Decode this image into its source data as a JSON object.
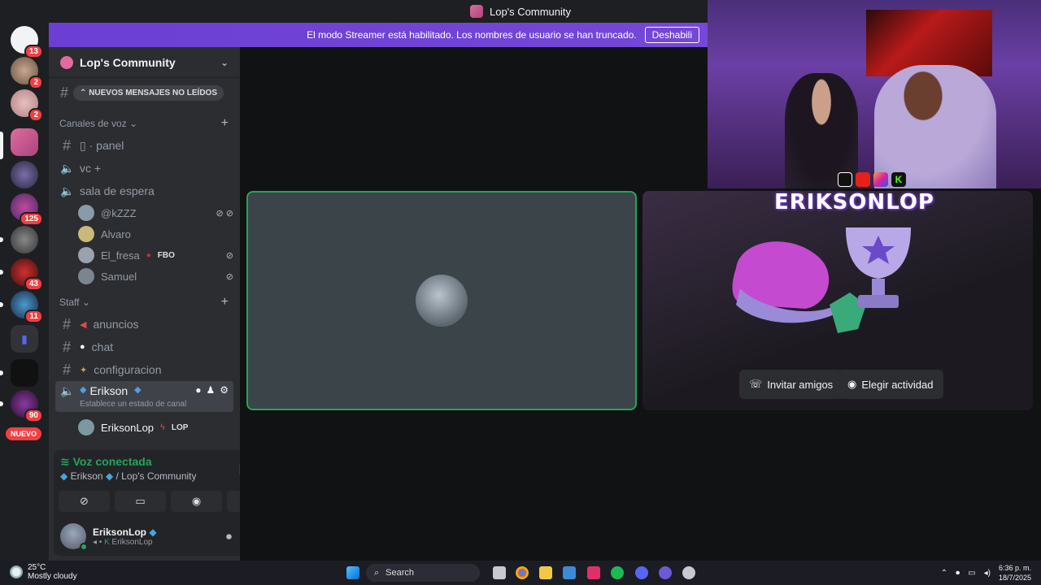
{
  "window": {
    "title": "Lop's Community"
  },
  "banner": {
    "text": "El modo Streamer está habilitado. Los nombres de usuario se han truncado.",
    "button": "Deshabili"
  },
  "server_rail": {
    "badges": [
      "13",
      "2",
      "2",
      "125",
      "43",
      "11",
      "90"
    ],
    "new_label": "NUEVO"
  },
  "sidebar": {
    "server_name": "Lop's Community",
    "unread_label": "NUEVOS MENSAJES NO LEÍDOS",
    "voice_category": "Canales de voz",
    "voice_channels": [
      {
        "name": "panel",
        "icon": "hash-icon"
      },
      {
        "name": "vc +",
        "icon": "speaker-icon"
      },
      {
        "name": "sala de espera",
        "icon": "speaker-icon"
      }
    ],
    "voice_users": [
      {
        "name": "@kZZZ",
        "tag": "",
        "color": "#8a9aa8"
      },
      {
        "name": "Alvaro",
        "tag": "",
        "color": "#c9b97a"
      },
      {
        "name": "El_fresa",
        "tag": "FBO",
        "color": "#9aa3ad"
      },
      {
        "name": "Samuel",
        "tag": "",
        "color": "#7a8590"
      }
    ],
    "staff_category": "Staff",
    "staff_channels": [
      {
        "name": "anuncios"
      },
      {
        "name": "chat"
      },
      {
        "name": "configuracion"
      }
    ],
    "active_channel": {
      "name": "Erikson",
      "status": "Establece un estado de canal"
    },
    "active_user": {
      "name": "EriksonLop",
      "tag": "LOP"
    }
  },
  "voice_panel": {
    "status": "Voz conectada",
    "channel": "Erikson",
    "server": "/ Lop's Community"
  },
  "user_panel": {
    "name": "EriksonLop",
    "sub": "EriksonLop"
  },
  "stage": {
    "invite_button": "Invitar amigos",
    "activity_button": "Elegir actividad"
  },
  "overlay": {
    "brand": "ERIKSONLOP",
    "social": [
      "tiktok-icon",
      "youtube-icon",
      "instagram-icon",
      "kick-icon"
    ]
  },
  "taskbar": {
    "temperature": "25°C",
    "weather": "Mostly cloudy",
    "search": "Search",
    "time": "6:36 p. m.",
    "date": "18/7/2025"
  },
  "colors": {
    "accent": "#5865f2",
    "online": "#23a55a",
    "danger": "#f23f43"
  }
}
